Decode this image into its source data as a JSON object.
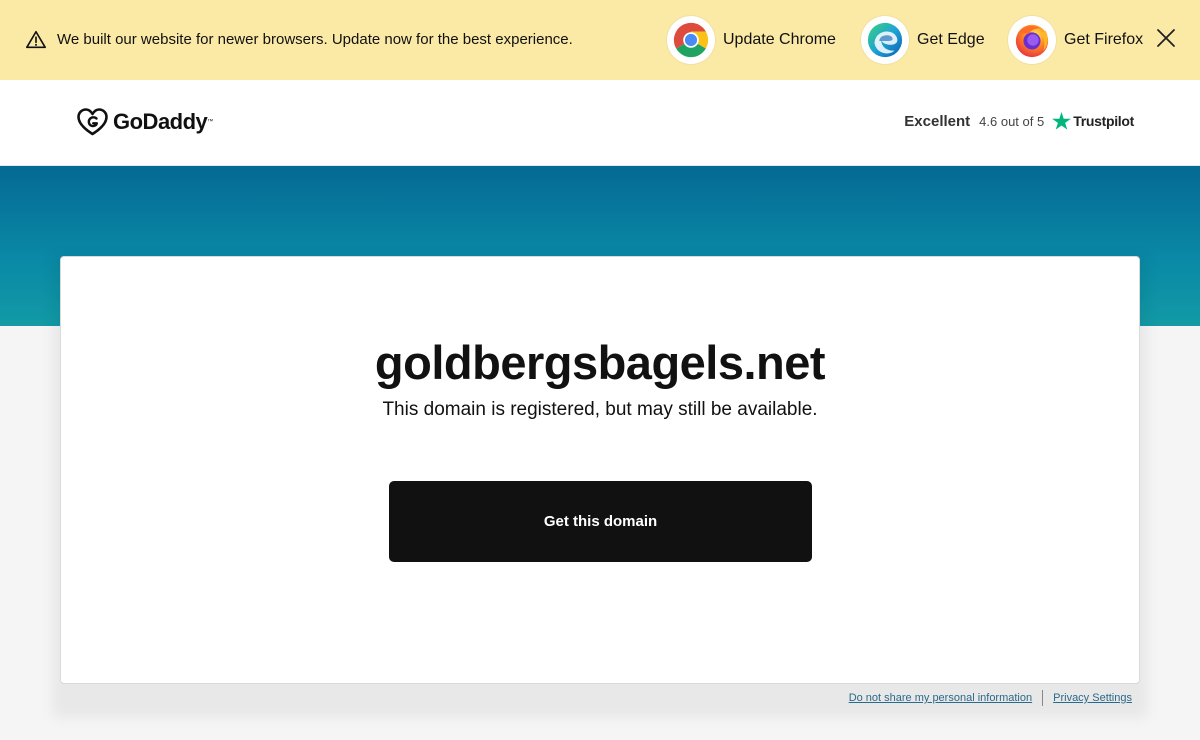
{
  "banner": {
    "message": "We built our website for newer browsers. Update now for the best experience.",
    "buttons": [
      {
        "label": "Update Chrome",
        "icon": "chrome-icon"
      },
      {
        "label": "Get Edge",
        "icon": "edge-icon"
      },
      {
        "label": "Get Firefox",
        "icon": "firefox-icon"
      }
    ],
    "warning_icon": "warning-triangle-icon",
    "close_icon": "close-icon",
    "background_color": "#fbeaa6"
  },
  "header": {
    "logo_text": "GoDaddy",
    "logo_icon": "godaddy-heart-icon",
    "rating_word": "Excellent",
    "rating_score": "4.6 out of 5",
    "rating_brand": "Trustpilot",
    "rating_brand_icon": "trustpilot-star-icon",
    "trustpilot_color": "#00b67a"
  },
  "hero": {
    "band_color": "#0a7fa0"
  },
  "card": {
    "domain": "goldbergsbagels.net",
    "status": "This domain is registered, but may still be available.",
    "cta_label": "Get this domain",
    "cta_color": "#111111"
  },
  "footer": {
    "links": [
      "Do not share my personal information",
      "Privacy Settings"
    ]
  }
}
